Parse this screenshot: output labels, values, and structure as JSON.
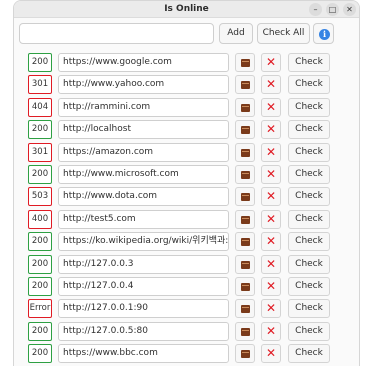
{
  "window": {
    "title": "Is Online"
  },
  "toolbar": {
    "url_placeholder": "",
    "add_label": "Add",
    "check_all_label": "Check All",
    "info_glyph": "i"
  },
  "controls": {
    "minimize": "–",
    "maximize": "□",
    "close": "✕"
  },
  "row_labels": {
    "check": "Check",
    "delete_glyph": "✕"
  },
  "colors": {
    "ok": "#2ea043",
    "error": "#e01b24",
    "info": "#3584e4",
    "open_icon": "#7a3a1a"
  },
  "rows": [
    {
      "status": "200",
      "url": "https://www.google.com",
      "state": "ok"
    },
    {
      "status": "301",
      "url": "http://www.yahoo.com",
      "state": "bad"
    },
    {
      "status": "404",
      "url": "http://rammini.com",
      "state": "bad"
    },
    {
      "status": "200",
      "url": "http://localhost",
      "state": "ok"
    },
    {
      "status": "301",
      "url": "https://amazon.com",
      "state": "bad"
    },
    {
      "status": "200",
      "url": "http://www.microsoft.com",
      "state": "ok"
    },
    {
      "status": "503",
      "url": "http://www.dota.com",
      "state": "bad"
    },
    {
      "status": "400",
      "url": "http://test5.com",
      "state": "bad"
    },
    {
      "status": "200",
      "url": "https://ko.wikipedia.org/wiki/위키백과:대문",
      "state": "ok"
    },
    {
      "status": "200",
      "url": "http://127.0.0.3",
      "state": "ok"
    },
    {
      "status": "200",
      "url": "http://127.0.0.4",
      "state": "ok"
    },
    {
      "status": "Error",
      "url": "http://127.0.0.1:90",
      "state": "bad"
    },
    {
      "status": "200",
      "url": "http://127.0.0.5:80",
      "state": "ok"
    },
    {
      "status": "200",
      "url": "https://www.bbc.com",
      "state": "ok"
    }
  ]
}
